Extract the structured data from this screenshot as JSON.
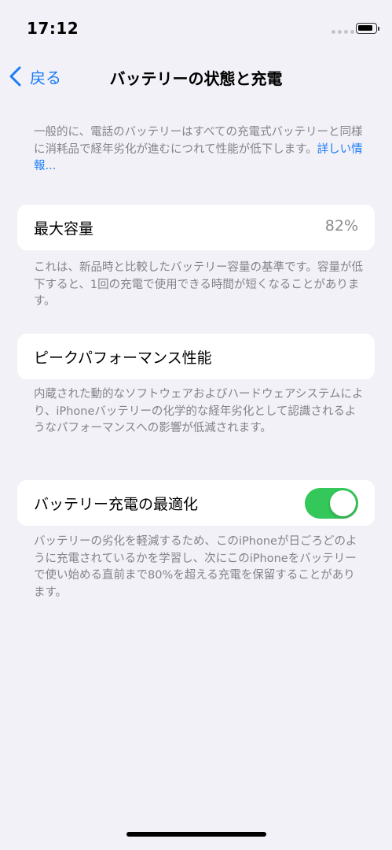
{
  "status_bar": {
    "time": "17:12"
  },
  "nav": {
    "back_label": "戻る",
    "title": "バッテリーの状態と充電"
  },
  "intro": {
    "text": "一般的に、電話のバッテリーはすべての充電式バッテリーと同様に消耗品で経年劣化が進むにつれて性能が低下します。",
    "link": "詳しい情報..."
  },
  "max_capacity": {
    "label": "最大容量",
    "value": "82%",
    "description": "これは、新品時と比較したバッテリー容量の基準です。容量が低下すると、1回の充電で使用できる時間が短くなることがあります。"
  },
  "peak_performance": {
    "label": "ピークパフォーマンス性能",
    "description": "内蔵された動的なソフトウェアおよびハードウェアシステムにより、iPhoneバッテリーの化学的な経年劣化として認識されるようなパフォーマンスへの影響が低減されます。"
  },
  "optimized_charging": {
    "label": "バッテリー充電の最適化",
    "enabled": true,
    "description": "バッテリーの劣化を軽減するため、このiPhoneが日ごろどのように充電されているかを学習し、次にこのiPhoneをバッテリーで使い始める直前まで80%を超える充電を保留することがあります。"
  },
  "colors": {
    "accent": "#1a7cf6",
    "toggle_on": "#34c759",
    "background": "#f2f1f7"
  },
  "icons": {
    "back": "chevron-left-icon",
    "battery": "battery-icon",
    "signal": "signal-icon"
  }
}
